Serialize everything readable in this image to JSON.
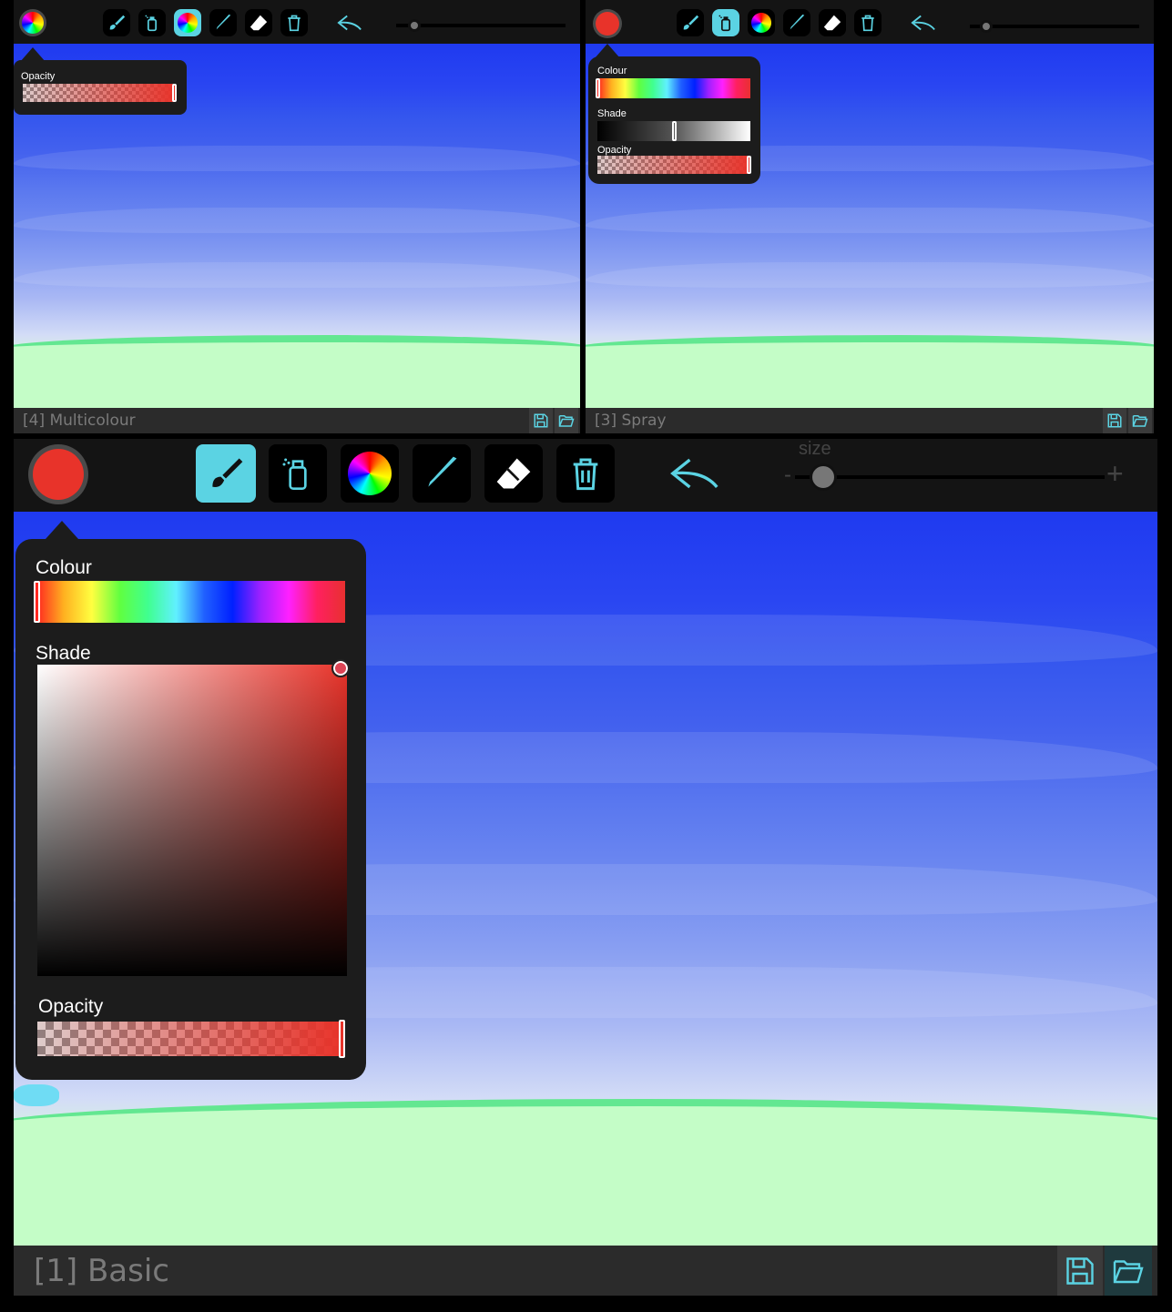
{
  "colors": {
    "accent": "#5bd3e3",
    "brush_color": "#e8332a",
    "toolbar_bg": "#141414",
    "footer_bg": "#2b2b2b",
    "popup_bg": "#1c1c1c"
  },
  "tools": [
    "brush-icon",
    "spray-icon",
    "multicolour-icon",
    "pen-icon",
    "eraser-icon",
    "trash-icon"
  ],
  "panel_top_left": {
    "label": "[4] Multicolour",
    "active_tool": "multicolour",
    "popup": {
      "opacity_label": "Opacity"
    }
  },
  "panel_top_right": {
    "label": "[3] Spray",
    "active_tool": "spray",
    "popup": {
      "colour_label": "Colour",
      "shade_label": "Shade",
      "opacity_label": "Opacity"
    }
  },
  "panel_main": {
    "label": "[1] Basic",
    "active_tool": "brush",
    "size_label": "size",
    "size_minus": "-",
    "size_plus": "+",
    "popup": {
      "colour_label": "Colour",
      "shade_label": "Shade",
      "opacity_label": "Opacity"
    }
  }
}
